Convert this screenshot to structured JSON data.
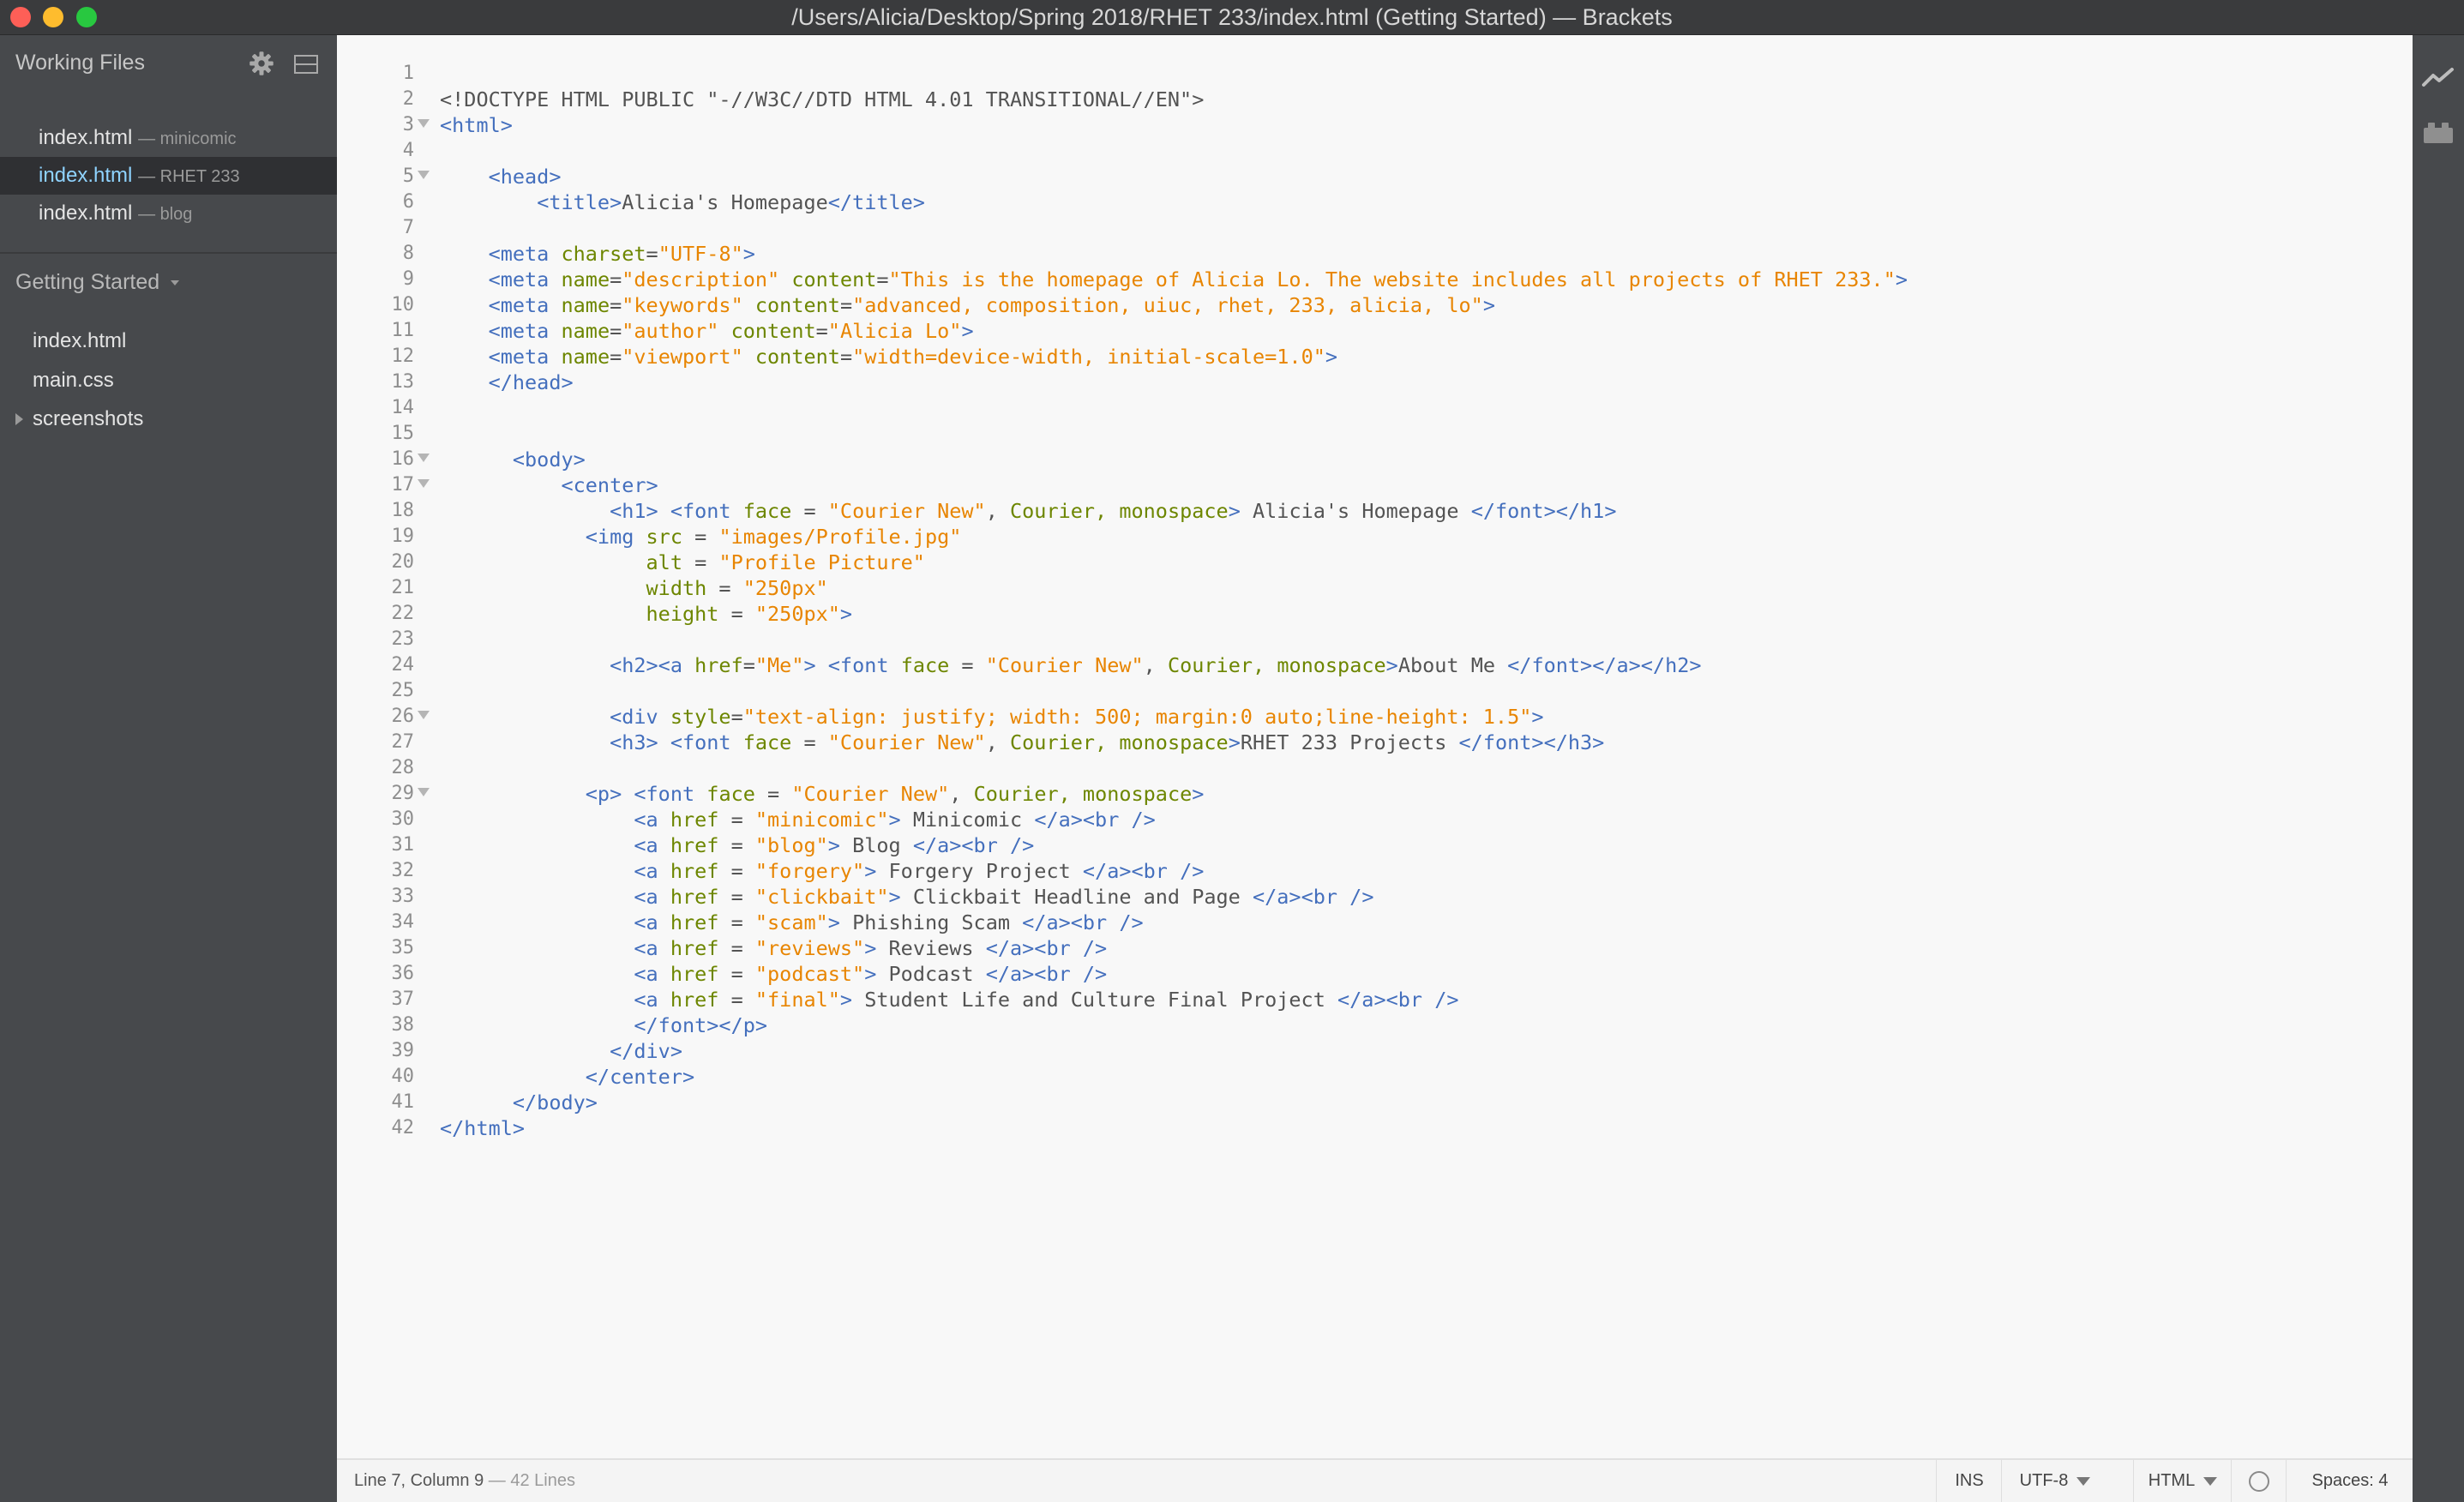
{
  "window": {
    "title": "/Users/Alicia/Desktop/Spring 2018/RHET 233/index.html (Getting Started) — Brackets"
  },
  "sidebar": {
    "working_files_header": "Working Files",
    "working_files": [
      {
        "name": "index.html",
        "context": "— minicomic",
        "active": false
      },
      {
        "name": "index.html",
        "context": "— RHET 233",
        "active": true
      },
      {
        "name": "index.html",
        "context": "— blog",
        "active": false
      }
    ],
    "project_name": "Getting Started",
    "project_files": [
      {
        "name": "index.html",
        "type": "file"
      },
      {
        "name": "main.css",
        "type": "file"
      },
      {
        "name": "screenshots",
        "type": "folder"
      }
    ]
  },
  "editor": {
    "lines": [
      [],
      [
        [
          "x",
          "<!DOCTYPE HTML PUBLIC \"-//W3C//DTD HTML 4.01 TRANSITIONAL//EN\">"
        ]
      ],
      [
        [
          "t",
          "<html>"
        ]
      ],
      [],
      [
        [
          "x",
          "    "
        ],
        [
          "t",
          "<head>"
        ]
      ],
      [
        [
          "x",
          "        "
        ],
        [
          "t",
          "<title>"
        ],
        [
          "x",
          "Alicia's Homepage"
        ],
        [
          "t",
          "</title>"
        ]
      ],
      [],
      [
        [
          "x",
          "    "
        ],
        [
          "t",
          "<meta"
        ],
        [
          "x",
          " "
        ],
        [
          "a",
          "charset"
        ],
        [
          "x",
          "="
        ],
        [
          "s",
          "\"UTF-8\""
        ],
        [
          "t",
          ">"
        ]
      ],
      [
        [
          "x",
          "    "
        ],
        [
          "t",
          "<meta"
        ],
        [
          "x",
          " "
        ],
        [
          "a",
          "name"
        ],
        [
          "x",
          "="
        ],
        [
          "s",
          "\"description\""
        ],
        [
          "x",
          " "
        ],
        [
          "a",
          "content"
        ],
        [
          "x",
          "="
        ],
        [
          "s",
          "\"This is the homepage of Alicia Lo. The website includes all projects of RHET 233.\""
        ],
        [
          "t",
          ">"
        ]
      ],
      [
        [
          "x",
          "    "
        ],
        [
          "t",
          "<meta"
        ],
        [
          "x",
          " "
        ],
        [
          "a",
          "name"
        ],
        [
          "x",
          "="
        ],
        [
          "s",
          "\"keywords\""
        ],
        [
          "x",
          " "
        ],
        [
          "a",
          "content"
        ],
        [
          "x",
          "="
        ],
        [
          "s",
          "\"advanced, composition, uiuc, rhet, 233, alicia, lo\""
        ],
        [
          "t",
          ">"
        ]
      ],
      [
        [
          "x",
          "    "
        ],
        [
          "t",
          "<meta"
        ],
        [
          "x",
          " "
        ],
        [
          "a",
          "name"
        ],
        [
          "x",
          "="
        ],
        [
          "s",
          "\"author\""
        ],
        [
          "x",
          " "
        ],
        [
          "a",
          "content"
        ],
        [
          "x",
          "="
        ],
        [
          "s",
          "\"Alicia Lo\""
        ],
        [
          "t",
          ">"
        ]
      ],
      [
        [
          "x",
          "    "
        ],
        [
          "t",
          "<meta"
        ],
        [
          "x",
          " "
        ],
        [
          "a",
          "name"
        ],
        [
          "x",
          "="
        ],
        [
          "s",
          "\"viewport\""
        ],
        [
          "x",
          " "
        ],
        [
          "a",
          "content"
        ],
        [
          "x",
          "="
        ],
        [
          "s",
          "\"width=device-width, initial-scale=1.0\""
        ],
        [
          "t",
          ">"
        ]
      ],
      [
        [
          "x",
          "    "
        ],
        [
          "t",
          "</head>"
        ]
      ],
      [],
      [],
      [
        [
          "x",
          "      "
        ],
        [
          "t",
          "<body>"
        ]
      ],
      [
        [
          "x",
          "          "
        ],
        [
          "t",
          "<center>"
        ]
      ],
      [
        [
          "x",
          "              "
        ],
        [
          "t",
          "<h1>"
        ],
        [
          "x",
          " "
        ],
        [
          "t",
          "<font"
        ],
        [
          "x",
          " "
        ],
        [
          "a",
          "face"
        ],
        [
          "x",
          " = "
        ],
        [
          "s",
          "\"Courier New\""
        ],
        [
          "x",
          ", "
        ],
        [
          "a",
          "Courier,"
        ],
        [
          "x",
          " "
        ],
        [
          "a",
          "monospace"
        ],
        [
          "t",
          ">"
        ],
        [
          "x",
          " Alicia's Homepage "
        ],
        [
          "t",
          "</font></h1>"
        ]
      ],
      [
        [
          "x",
          "            "
        ],
        [
          "t",
          "<img"
        ],
        [
          "x",
          " "
        ],
        [
          "a",
          "src"
        ],
        [
          "x",
          " = "
        ],
        [
          "s",
          "\"images/Profile.jpg\""
        ]
      ],
      [
        [
          "x",
          "                 "
        ],
        [
          "a",
          "alt"
        ],
        [
          "x",
          " = "
        ],
        [
          "s",
          "\"Profile Picture\""
        ]
      ],
      [
        [
          "x",
          "                 "
        ],
        [
          "a",
          "width"
        ],
        [
          "x",
          " = "
        ],
        [
          "s",
          "\"250px\""
        ]
      ],
      [
        [
          "x",
          "                 "
        ],
        [
          "a",
          "height"
        ],
        [
          "x",
          " = "
        ],
        [
          "s",
          "\"250px\""
        ],
        [
          "t",
          ">"
        ]
      ],
      [],
      [
        [
          "x",
          "              "
        ],
        [
          "t",
          "<h2><a"
        ],
        [
          "x",
          " "
        ],
        [
          "a",
          "href"
        ],
        [
          "x",
          "="
        ],
        [
          "s",
          "\"Me\""
        ],
        [
          "t",
          ">"
        ],
        [
          "x",
          " "
        ],
        [
          "t",
          "<font"
        ],
        [
          "x",
          " "
        ],
        [
          "a",
          "face"
        ],
        [
          "x",
          " = "
        ],
        [
          "s",
          "\"Courier New\""
        ],
        [
          "x",
          ", "
        ],
        [
          "a",
          "Courier,"
        ],
        [
          "x",
          " "
        ],
        [
          "a",
          "monospace"
        ],
        [
          "t",
          ">"
        ],
        [
          "x",
          "About Me "
        ],
        [
          "t",
          "</font></a></h2>"
        ]
      ],
      [],
      [
        [
          "x",
          "              "
        ],
        [
          "t",
          "<div"
        ],
        [
          "x",
          " "
        ],
        [
          "a",
          "style"
        ],
        [
          "x",
          "="
        ],
        [
          "s",
          "\"text-align: justify; width: 500; margin:0 auto;line-height: 1.5\""
        ],
        [
          "t",
          ">"
        ]
      ],
      [
        [
          "x",
          "              "
        ],
        [
          "t",
          "<h3>"
        ],
        [
          "x",
          " "
        ],
        [
          "t",
          "<font"
        ],
        [
          "x",
          " "
        ],
        [
          "a",
          "face"
        ],
        [
          "x",
          " = "
        ],
        [
          "s",
          "\"Courier New\""
        ],
        [
          "x",
          ", "
        ],
        [
          "a",
          "Courier,"
        ],
        [
          "x",
          " "
        ],
        [
          "a",
          "monospace"
        ],
        [
          "t",
          ">"
        ],
        [
          "x",
          "RHET 233 Projects "
        ],
        [
          "t",
          "</font></h3>"
        ]
      ],
      [],
      [
        [
          "x",
          "            "
        ],
        [
          "t",
          "<p>"
        ],
        [
          "x",
          " "
        ],
        [
          "t",
          "<font"
        ],
        [
          "x",
          " "
        ],
        [
          "a",
          "face"
        ],
        [
          "x",
          " = "
        ],
        [
          "s",
          "\"Courier New\""
        ],
        [
          "x",
          ", "
        ],
        [
          "a",
          "Courier,"
        ],
        [
          "x",
          " "
        ],
        [
          "a",
          "monospace"
        ],
        [
          "t",
          ">"
        ]
      ],
      [
        [
          "x",
          "                "
        ],
        [
          "t",
          "<a"
        ],
        [
          "x",
          " "
        ],
        [
          "a",
          "href"
        ],
        [
          "x",
          " = "
        ],
        [
          "s",
          "\"minicomic\""
        ],
        [
          "t",
          ">"
        ],
        [
          "x",
          " Minicomic "
        ],
        [
          "t",
          "</a><br />"
        ]
      ],
      [
        [
          "x",
          "                "
        ],
        [
          "t",
          "<a"
        ],
        [
          "x",
          " "
        ],
        [
          "a",
          "href"
        ],
        [
          "x",
          " = "
        ],
        [
          "s",
          "\"blog\""
        ],
        [
          "t",
          ">"
        ],
        [
          "x",
          " Blog "
        ],
        [
          "t",
          "</a><br />"
        ]
      ],
      [
        [
          "x",
          "                "
        ],
        [
          "t",
          "<a"
        ],
        [
          "x",
          " "
        ],
        [
          "a",
          "href"
        ],
        [
          "x",
          " = "
        ],
        [
          "s",
          "\"forgery\""
        ],
        [
          "t",
          ">"
        ],
        [
          "x",
          " Forgery Project "
        ],
        [
          "t",
          "</a><br />"
        ]
      ],
      [
        [
          "x",
          "                "
        ],
        [
          "t",
          "<a"
        ],
        [
          "x",
          " "
        ],
        [
          "a",
          "href"
        ],
        [
          "x",
          " = "
        ],
        [
          "s",
          "\"clickbait\""
        ],
        [
          "t",
          ">"
        ],
        [
          "x",
          " Clickbait Headline and Page "
        ],
        [
          "t",
          "</a><br />"
        ]
      ],
      [
        [
          "x",
          "                "
        ],
        [
          "t",
          "<a"
        ],
        [
          "x",
          " "
        ],
        [
          "a",
          "href"
        ],
        [
          "x",
          " = "
        ],
        [
          "s",
          "\"scam\""
        ],
        [
          "t",
          ">"
        ],
        [
          "x",
          " Phishing Scam "
        ],
        [
          "t",
          "</a><br />"
        ]
      ],
      [
        [
          "x",
          "                "
        ],
        [
          "t",
          "<a"
        ],
        [
          "x",
          " "
        ],
        [
          "a",
          "href"
        ],
        [
          "x",
          " = "
        ],
        [
          "s",
          "\"reviews\""
        ],
        [
          "t",
          ">"
        ],
        [
          "x",
          " Reviews "
        ],
        [
          "t",
          "</a><br />"
        ]
      ],
      [
        [
          "x",
          "                "
        ],
        [
          "t",
          "<a"
        ],
        [
          "x",
          " "
        ],
        [
          "a",
          "href"
        ],
        [
          "x",
          " = "
        ],
        [
          "s",
          "\"podcast\""
        ],
        [
          "t",
          ">"
        ],
        [
          "x",
          " Podcast "
        ],
        [
          "t",
          "</a><br />"
        ]
      ],
      [
        [
          "x",
          "                "
        ],
        [
          "t",
          "<a"
        ],
        [
          "x",
          " "
        ],
        [
          "a",
          "href"
        ],
        [
          "x",
          " = "
        ],
        [
          "s",
          "\"final\""
        ],
        [
          "t",
          ">"
        ],
        [
          "x",
          " Student Life and Culture Final Project "
        ],
        [
          "t",
          "</a><br />"
        ]
      ],
      [
        [
          "x",
          "                "
        ],
        [
          "t",
          "</font></p>"
        ]
      ],
      [
        [
          "x",
          "              "
        ],
        [
          "t",
          "</div>"
        ]
      ],
      [
        [
          "x",
          "            "
        ],
        [
          "t",
          "</center>"
        ]
      ],
      [
        [
          "x",
          "      "
        ],
        [
          "t",
          "</body>"
        ]
      ],
      [
        [
          "t",
          "</html>"
        ]
      ]
    ],
    "fold_lines": [
      3,
      5,
      16,
      17,
      26,
      29
    ]
  },
  "statusbar": {
    "cursor": "Line 7, Column 9",
    "line_count": "— 42 Lines",
    "mode": "INS",
    "encoding": "UTF-8",
    "language": "HTML",
    "indent": "Spaces:  4"
  },
  "colors": {
    "tag": "#446fbd",
    "attribute": "#6d8600",
    "string": "#e88501",
    "text": "#535353",
    "active_file": "#8fd3ff"
  },
  "icons": {
    "window_controls": [
      "close-button",
      "minimize-button",
      "zoom-button"
    ],
    "sidebar_header": [
      "gear-icon",
      "split-view-icon"
    ],
    "right_toolbar": [
      "live-preview-icon",
      "extension-manager-icon"
    ],
    "statusbar": [
      "linting-status-icon"
    ]
  }
}
